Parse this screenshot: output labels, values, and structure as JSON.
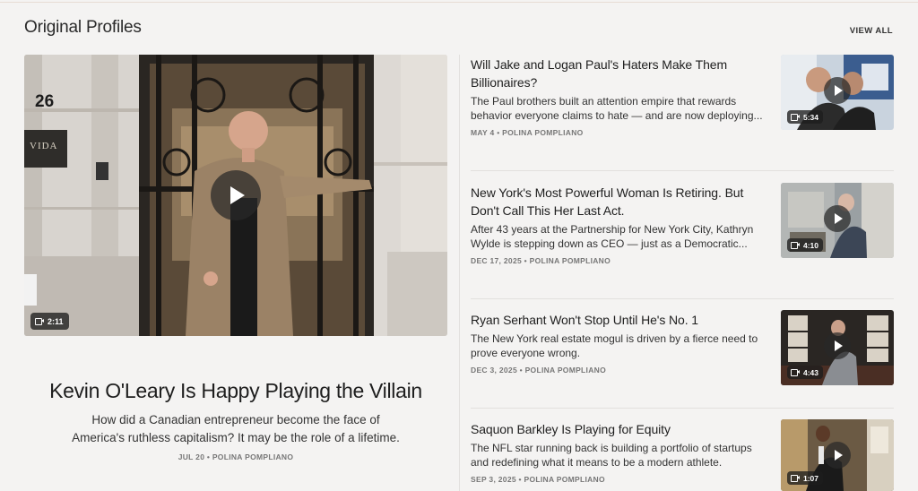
{
  "section": {
    "title": "Original Profiles",
    "view_all": "VIEW ALL"
  },
  "featured": {
    "title": "Kevin O'Leary Is Happy Playing the Villain",
    "description": "How did a Canadian entrepreneur become the face of America's ruthless capitalism? It may be the role of a lifetime.",
    "meta": "JUL 20 • POLINA POMPLIANO",
    "duration": "2:11",
    "sign_number": "26",
    "sign_text": "VIDA"
  },
  "items": [
    {
      "title": "Will Jake and Logan Paul's Haters Make Them Billionaires?",
      "description": "The Paul brothers built an attention empire that rewards behavior everyone claims to hate — and are now deploying...",
      "meta": "MAY 4 • POLINA POMPLIANO",
      "duration": "5:34"
    },
    {
      "title": "New York's Most Powerful Woman Is Retiring. But Don't Call This Her Last Act.",
      "description": "After 43 years at the Partnership for New York City, Kathryn Wylde is stepping down as CEO — just as a Democratic...",
      "meta": "DEC 17, 2025 • POLINA POMPLIANO",
      "duration": "4:10"
    },
    {
      "title": "Ryan Serhant Won't Stop Until He's No. 1",
      "description": "The New York real estate mogul is driven by a fierce need to prove everyone wrong.",
      "meta": "DEC 3, 2025 • POLINA POMPLIANO",
      "duration": "4:43"
    },
    {
      "title": "Saquon Barkley Is Playing for Equity",
      "description": "The NFL star running back is building a portfolio of startups and redefining what it means to be a modern athlete.",
      "meta": "SEP 3, 2025 • POLINA POMPLIANO",
      "duration": "1:07"
    }
  ]
}
